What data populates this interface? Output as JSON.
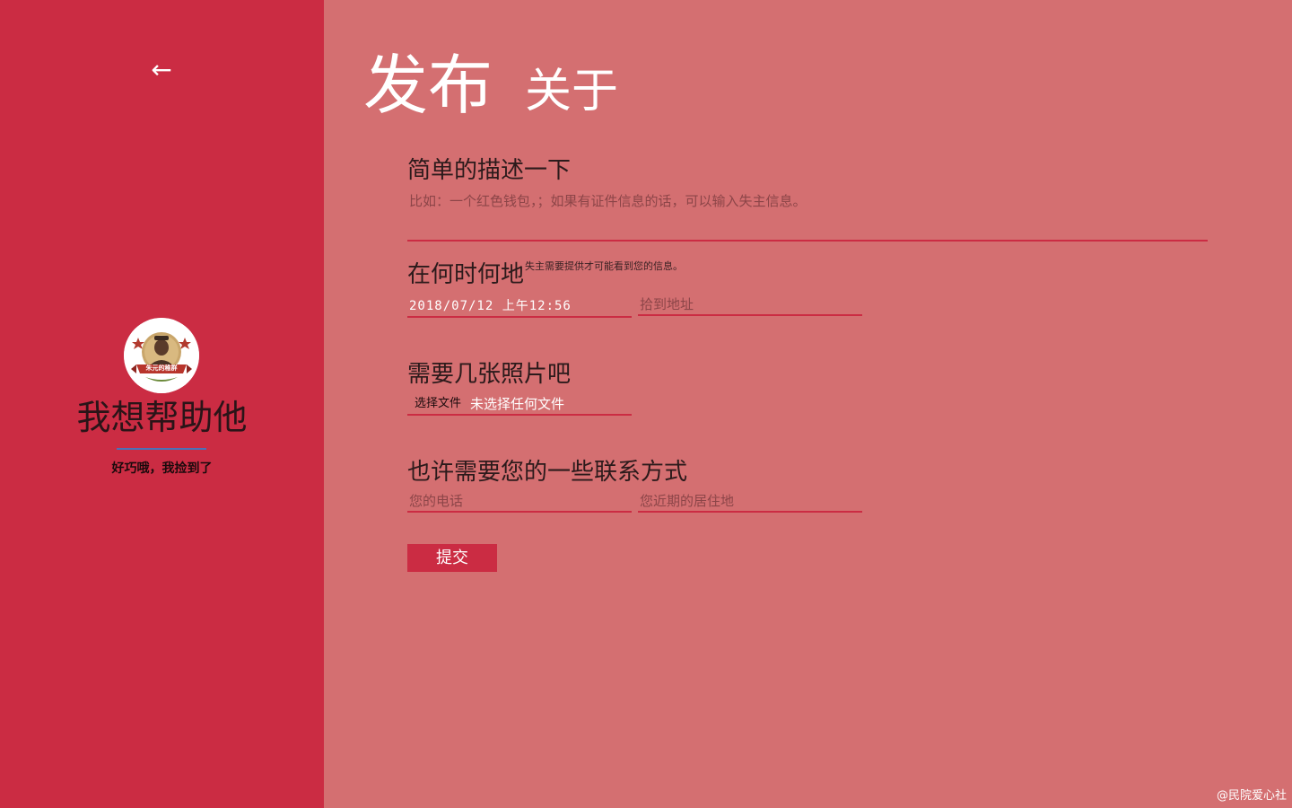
{
  "sidebar": {
    "back_icon": "←",
    "avatar_badge_text": "朱元的稚群",
    "title": "我想帮助他",
    "subtitle": "好巧哦，我捡到了"
  },
  "header": {
    "title": "发布",
    "subtitle": "关于"
  },
  "sections": {
    "description": {
      "heading": "简单的描述一下",
      "placeholder": "比如：一个红色钱包，；如果有证件信息的话，可以输入失主信息。"
    },
    "when_where": {
      "heading": "在何时何地",
      "note": "失主需要提供才可能看到您的信息。",
      "datetime_value": "2018/07/12 上午12:56",
      "address_placeholder": "拾到地址"
    },
    "photos": {
      "heading": "需要几张照片吧",
      "file_button_label": "选择文件",
      "file_status": "未选择任何文件"
    },
    "contact": {
      "heading": "也许需要您的一些联系方式",
      "phone_placeholder": "您的电话",
      "residence_placeholder": "您近期的居住地"
    }
  },
  "submit_label": "提交",
  "footer": {
    "credit": "@民院爱心社"
  },
  "colors": {
    "sidebar_bg": "#cb2c43",
    "main_bg": "#d46f71",
    "accent": "#cb2c43",
    "divider": "#4a72b8"
  }
}
